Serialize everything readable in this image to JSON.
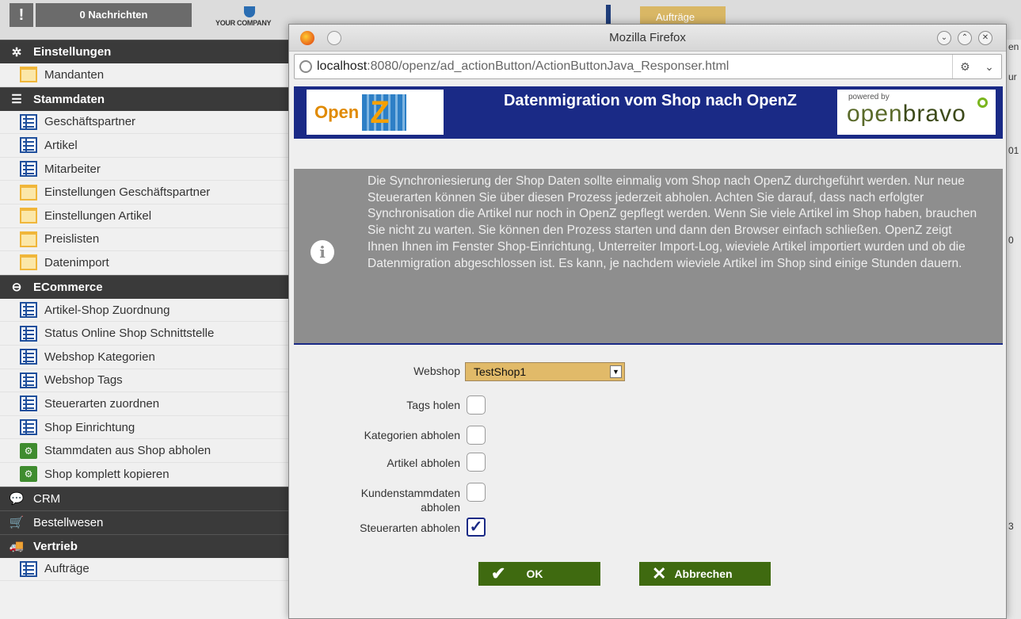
{
  "topbar": {
    "warning_symbol": "!",
    "messages": "0 Nachrichten",
    "company": "YOUR COMPANY",
    "orders_tab": "Aufträge"
  },
  "sidebar": {
    "sections": [
      {
        "id": "einstellungen",
        "label": "Einstellungen",
        "icon": "gear-icon"
      },
      {
        "id": "stammdaten",
        "label": "Stammdaten",
        "icon": "menu-icon"
      },
      {
        "id": "ecommerce",
        "label": "ECommerce",
        "icon": "minus-circle-icon"
      },
      {
        "id": "crm",
        "label": "CRM",
        "icon": "chat-icon"
      },
      {
        "id": "bestellwesen",
        "label": "Bestellwesen",
        "icon": "cart-icon"
      },
      {
        "id": "vertrieb",
        "label": "Vertrieb",
        "icon": "truck-icon"
      }
    ],
    "items": {
      "mandanten": "Mandanten",
      "geschaeftspartner": "Geschäftspartner",
      "artikel": "Artikel",
      "mitarbeiter": "Mitarbeiter",
      "einst_gp": "Einstellungen Geschäftspartner",
      "einst_artikel": "Einstellungen Artikel",
      "preislisten": "Preislisten",
      "datenimport": "Datenimport",
      "artikel_shop": "Artikel-Shop Zuordnung",
      "status_shop": "Status Online Shop Schnittstelle",
      "webshop_kat": "Webshop Kategorien",
      "webshop_tags": "Webshop Tags",
      "steuerarten": "Steuerarten zuordnen",
      "shop_einrichtung": "Shop Einrichtung",
      "stamm_abholen": "Stammdaten aus Shop abholen",
      "shop_kopieren": "Shop komplett kopieren",
      "auftraege": "Aufträge"
    }
  },
  "right_strip": {
    "chip1": "en",
    "chip2": "ur",
    "chip3": "01",
    "chip4": "0",
    "chip5": "3"
  },
  "firefox": {
    "title": "Mozilla Firefox",
    "url_host": "localhost",
    "url_path": ":8080/openz/ad_actionButton/ActionButtonJava_Responser.html",
    "btn_min": "⌄",
    "btn_max": "⌃",
    "btn_close": "✕"
  },
  "dialog": {
    "logo_left_text": "Open",
    "logo_left_mark": "Z",
    "title": "Datenmigration vom Shop nach OpenZ",
    "powered_by": "powered by",
    "logo_right_text_a": "open",
    "logo_right_text_b": "bravo",
    "info_text": "Die Synchroniesierung der Shop Daten sollte einmalig vom Shop nach OpenZ durchgeführt werden. Nur neue Steuerarten können Sie über diesen Prozess jederzeit abholen. Achten Sie darauf, dass nach erfolgter Synchronisation die Artikel nur noch in OpenZ gepflegt werden. Wenn Sie viele Artikel im Shop haben, brauchen Sie nicht zu warten. Sie können den Prozess starten und dann den Browser einfach schließen. OpenZ zeigt Ihnen Ihnen im Fenster Shop-Einrichtung, Unterreiter Import-Log, wieviele Artikel importiert wurden und ob die Datenmigration abgeschlossen ist. Es kann, je nachdem wieviele Artikel im Shop sind einige Stunden dauern.",
    "form": {
      "webshop_label": "Webshop",
      "webshop_value": "TestShop1",
      "tags_label": "Tags holen",
      "tags_checked": false,
      "kategorien_label": "Kategorien abholen",
      "kategorien_checked": false,
      "artikel_label": "Artikel abholen",
      "artikel_checked": false,
      "kunden_label_1": "Kundenstammdaten",
      "kunden_label_2": "abholen",
      "kunden_checked": false,
      "steuer_label": "Steuerarten abholen",
      "steuer_checked": true
    },
    "ok_label": "OK",
    "cancel_label": "Abbrechen"
  },
  "colors": {
    "header_blue": "#1a2a86",
    "button_green": "#3f6a10",
    "select_gold": "#e1ba69",
    "info_gray": "#8e8e8e"
  }
}
